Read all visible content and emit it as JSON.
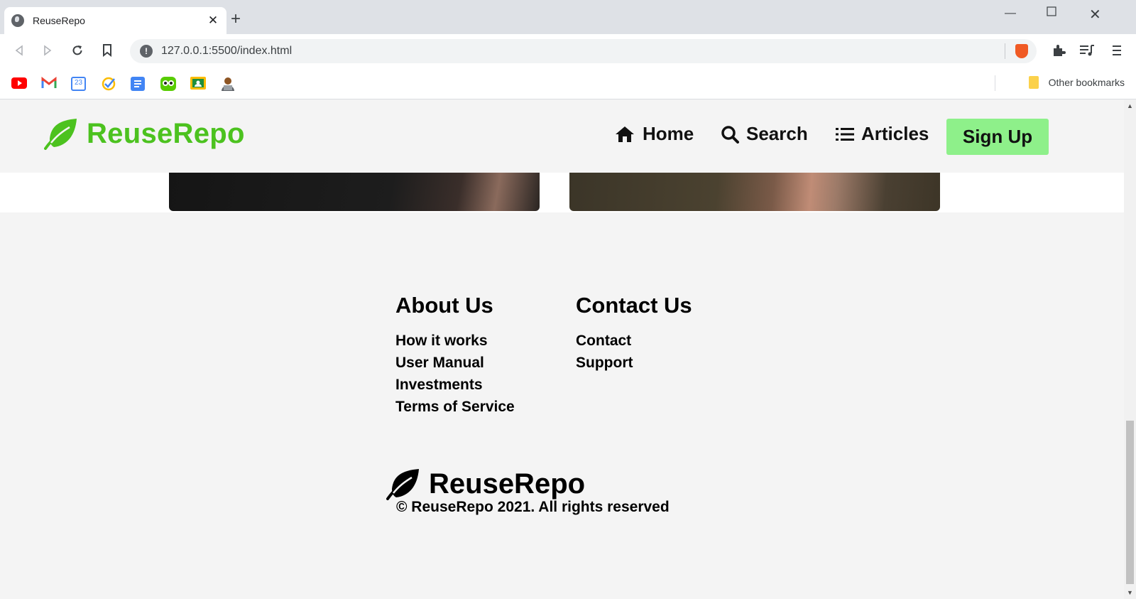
{
  "browser": {
    "tab_title": "ReuseRepo",
    "url": "127.0.0.1:5500/index.html",
    "other_bookmarks": "Other bookmarks",
    "bookmark_icons": [
      "youtube-icon",
      "gmail-icon",
      "calendar-icon",
      "tasks-icon",
      "docs-icon",
      "duolingo-icon",
      "classroom-icon",
      "avatar-icon"
    ],
    "calendar_date": "23"
  },
  "header": {
    "logo_text": "ReuseRepo",
    "nav": {
      "home": "Home",
      "search": "Search",
      "articles": "Articles"
    },
    "signup": "Sign Up",
    "brand_color": "#4cc21f",
    "signup_color": "#8ef08a"
  },
  "footer": {
    "about": {
      "heading": "About Us",
      "links": [
        "How it works",
        "User Manual",
        "Investments",
        "Terms of Service"
      ]
    },
    "contact": {
      "heading": "Contact Us",
      "links": [
        "Contact",
        "Support"
      ]
    },
    "logo_text": "ReuseRepo",
    "copyright": "© ReuseRepo 2021. All rights reserved"
  }
}
